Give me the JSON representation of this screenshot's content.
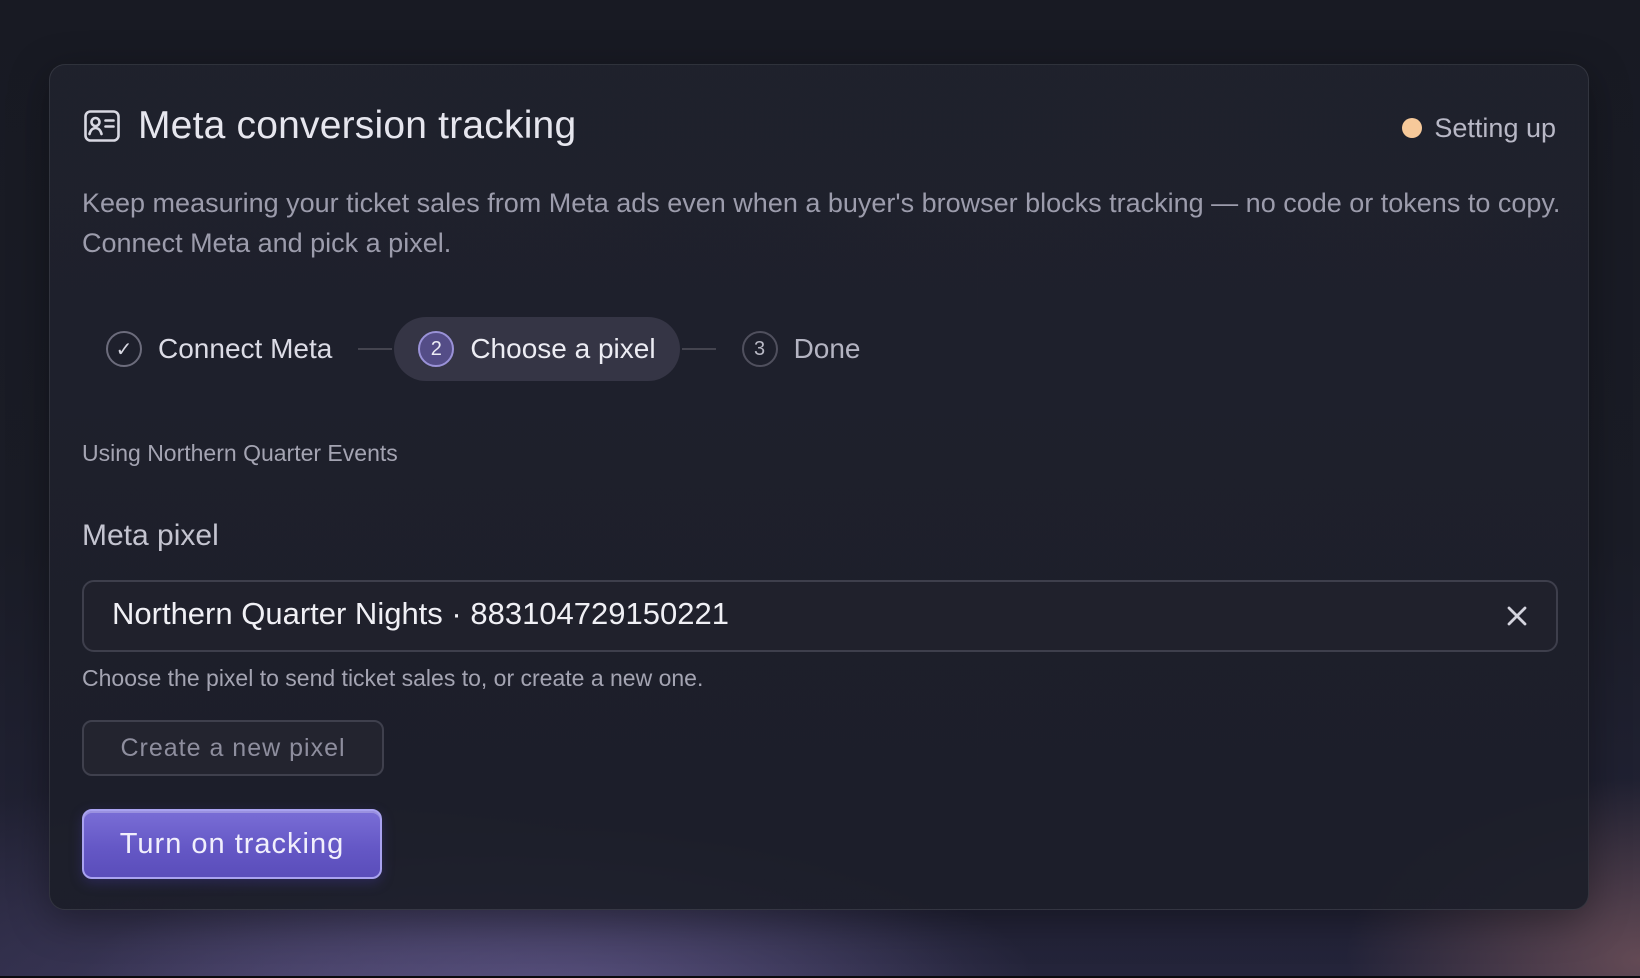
{
  "header": {
    "title": "Meta conversion tracking",
    "title_icon": "contact-card-icon",
    "status": {
      "label": "Setting up",
      "dot_color": "#f6c99a"
    }
  },
  "description": "Keep measuring your ticket sales from Meta ads even when a buyer's browser blocks tracking — no code or tokens to copy. Connect Meta and pick a pixel.",
  "stepper": {
    "steps": [
      {
        "marker": "✓",
        "label": "Connect Meta",
        "state": "complete"
      },
      {
        "marker": "2",
        "label": "Choose a pixel",
        "state": "active"
      },
      {
        "marker": "3",
        "label": "Done",
        "state": "pending"
      }
    ]
  },
  "account": {
    "using_text": "Using Northern Quarter Events"
  },
  "pixel_field": {
    "label": "Meta pixel",
    "selected_value": "Northern Quarter Nights · 883104729150221",
    "help_text": "Choose the pixel to send ticket sales to, or create a new one."
  },
  "actions": {
    "create_label": "Create a new pixel",
    "primary_label": "Turn on tracking",
    "accent_color": "#6558c6"
  }
}
